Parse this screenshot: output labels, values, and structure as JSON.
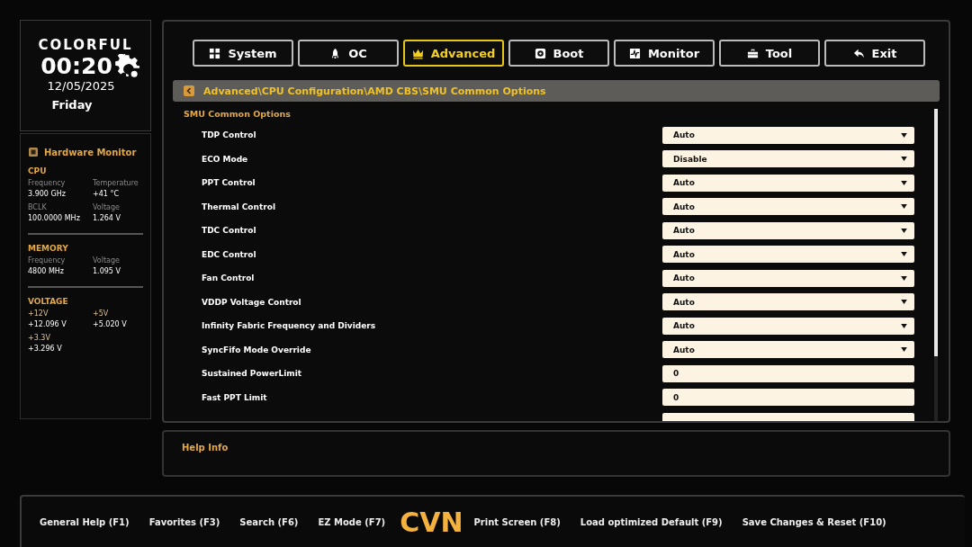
{
  "brand": {
    "logo": "COLORFUL",
    "time": "00:20",
    "date": "12/05/2025",
    "weekday": "Friday"
  },
  "hardware_monitor": {
    "title": "Hardware Monitor",
    "sections": [
      {
        "title": "CPU",
        "kind": "pairs",
        "items": [
          {
            "label": "Frequency",
            "value": "3.900 GHz"
          },
          {
            "label": "Temperature",
            "value": "+41 °C"
          },
          {
            "label": "BCLK",
            "value": "100.0000 MHz"
          },
          {
            "label": "Voltage",
            "value": "1.264 V"
          }
        ]
      },
      {
        "title": "MEMORY",
        "kind": "pairs",
        "items": [
          {
            "label": "Frequency",
            "value": "4800 MHz"
          },
          {
            "label": "Voltage",
            "value": "1.095 V"
          }
        ]
      },
      {
        "title": "VOLTAGE",
        "kind": "rails",
        "items": [
          {
            "label": "+12V",
            "value": "+12.096 V"
          },
          {
            "label": "+5V",
            "value": "+5.020 V"
          },
          {
            "label": "+3.3V",
            "value": "+3.296 V"
          }
        ]
      }
    ]
  },
  "tabs": [
    {
      "label": "System",
      "selected": false
    },
    {
      "label": "OC",
      "selected": false
    },
    {
      "label": "Advanced",
      "selected": true
    },
    {
      "label": "Boot",
      "selected": false
    },
    {
      "label": "Monitor",
      "selected": false
    },
    {
      "label": "Tool",
      "selected": false
    },
    {
      "label": "Exit",
      "selected": false
    }
  ],
  "breadcrumb": "Advanced\\CPU Configuration\\AMD CBS\\SMU Common Options",
  "section_title": "SMU Common Options",
  "settings": [
    {
      "label": "TDP Control",
      "kind": "dropdown",
      "value": "Auto"
    },
    {
      "label": "ECO Mode",
      "kind": "dropdown",
      "value": "Disable"
    },
    {
      "label": "PPT Control",
      "kind": "dropdown",
      "value": "Auto"
    },
    {
      "label": "Thermal Control",
      "kind": "dropdown",
      "value": "Auto"
    },
    {
      "label": "TDC Control",
      "kind": "dropdown",
      "value": "Auto"
    },
    {
      "label": "EDC Control",
      "kind": "dropdown",
      "value": "Auto"
    },
    {
      "label": "Fan Control",
      "kind": "dropdown",
      "value": "Auto"
    },
    {
      "label": "VDDP Voltage Control",
      "kind": "dropdown",
      "value": "Auto"
    },
    {
      "label": "Infinity Fabric Frequency and Dividers",
      "kind": "dropdown",
      "value": "Auto"
    },
    {
      "label": "SyncFifo Mode Override",
      "kind": "dropdown",
      "value": "Auto"
    },
    {
      "label": "Sustained PowerLimit",
      "kind": "number",
      "value": "0"
    },
    {
      "label": "Fast PPT Limit",
      "kind": "number",
      "value": "0"
    }
  ],
  "help_info": {
    "title": "Help Info"
  },
  "footer": {
    "left": [
      "General Help (F1)",
      "Favorites (F3)",
      "Search (F6)",
      "EZ Mode (F7)"
    ],
    "logo": "CVN",
    "right": [
      "Print Screen (F8)",
      "Load optimized Default (F9)",
      "Save Changes & Reset (F10)"
    ]
  }
}
